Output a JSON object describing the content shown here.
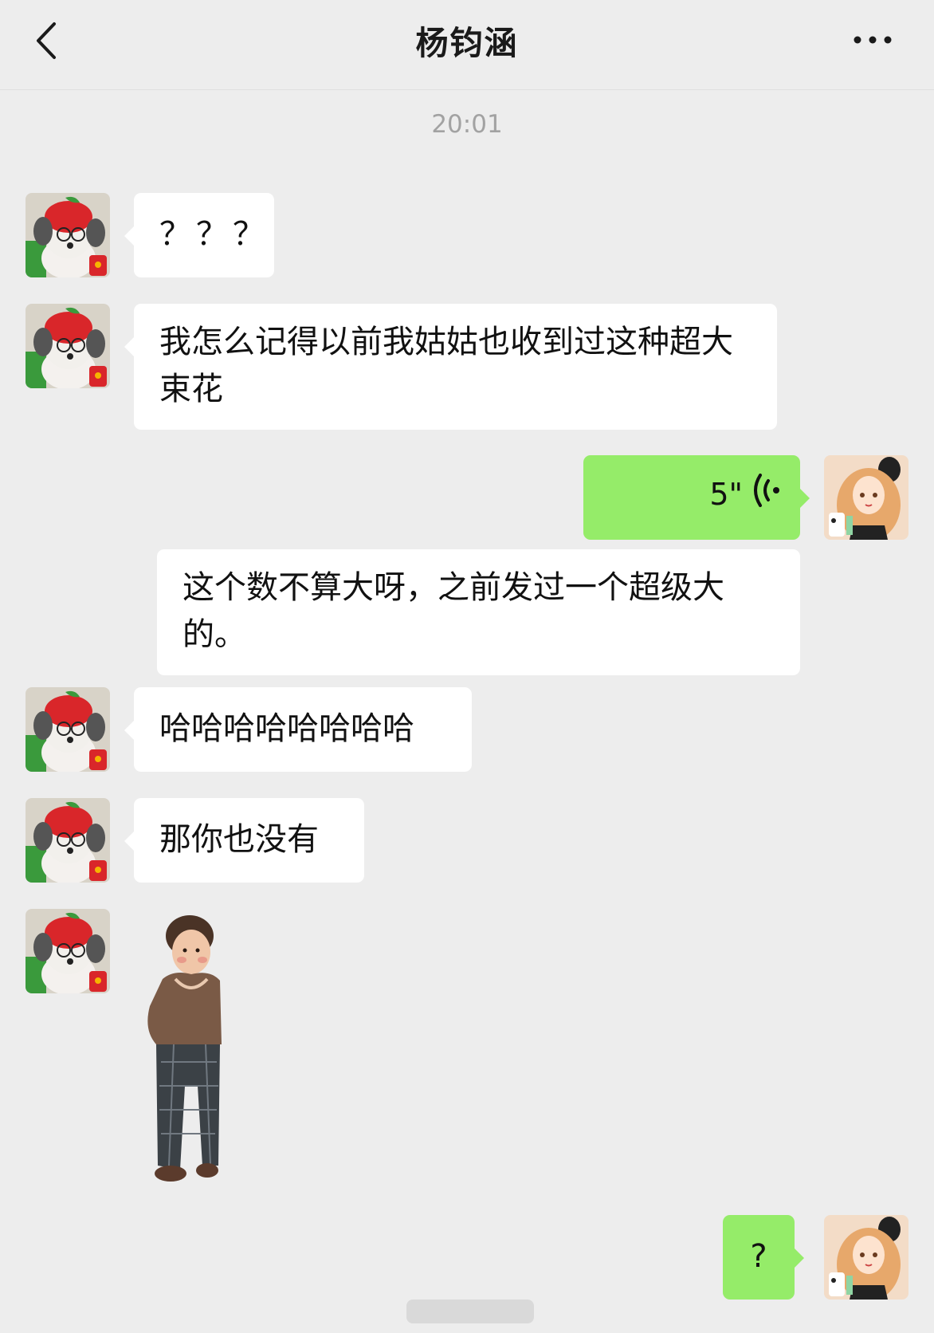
{
  "header": {
    "back_icon": "chevron-left-icon",
    "title": "杨钧涵",
    "more_icon": "more-dots-icon"
  },
  "timestamp": "20:01",
  "messages": [
    {
      "side": "left",
      "type": "text",
      "text": "？？？"
    },
    {
      "side": "left",
      "type": "text",
      "text": "我怎么记得以前我姑姑也收到过这种超大束花"
    },
    {
      "side": "right",
      "type": "voice",
      "duration": "5\""
    },
    {
      "side": "right",
      "type": "transcript",
      "text": "这个数不算大呀，之前发过一个超级大的。"
    },
    {
      "side": "left",
      "type": "text",
      "text": "哈哈哈哈哈哈哈哈"
    },
    {
      "side": "left",
      "type": "text",
      "text": "那你也没有"
    },
    {
      "side": "left",
      "type": "sticker",
      "sticker": "child-standing-sticker"
    },
    {
      "side": "right",
      "type": "text",
      "text": "?"
    }
  ],
  "colors": {
    "background": "#ededed",
    "incoming_bubble": "#ffffff",
    "outgoing_bubble": "#95ec69",
    "timestamp": "#a2a2a2"
  }
}
